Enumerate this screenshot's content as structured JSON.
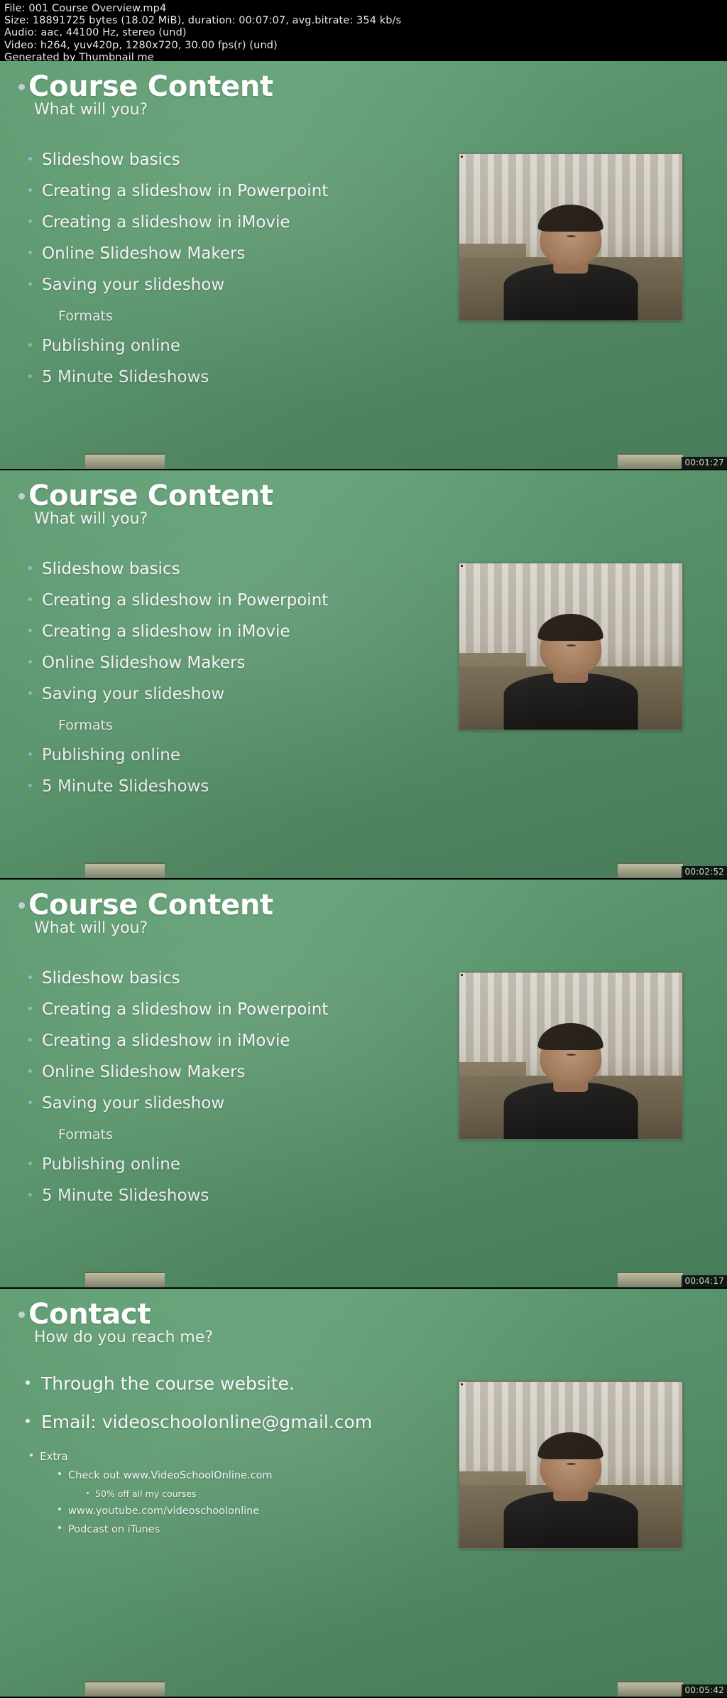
{
  "header": {
    "lines": [
      "File: 001 Course Overview.mp4",
      "Size: 18891725 bytes (18.02 MiB), duration: 00:07:07, avg.bitrate: 354 kb/s",
      "Audio: aac, 44100 Hz, stereo (und)",
      "Video: h264, yuv420p, 1280x720, 30.00 fps(r) (und)",
      "Generated by Thumbnail me"
    ],
    "file_label": "File: 001 Course Overview.mp4",
    "size_label": "Size: 18891725 bytes (18.02 MiB), duration: 00:07:07, avg.bitrate: 354 kb/s",
    "audio_label": "Audio: aac, 44100 Hz, stereo (und)",
    "video_label": "Video: h264, yuv420p, 1280x720, 30.00 fps(r) (und)",
    "generator_label": "Generated by Thumbnail me",
    "filename": "001 Course Overview.mp4",
    "size_bytes": "18891725",
    "size_human": "18.02 MiB",
    "duration": "00:07:07",
    "avg_bitrate": "354 kb/s",
    "audio_codec": "aac",
    "audio_rate": "44100 Hz",
    "audio_channels": "stereo (und)",
    "video_codec": "h264",
    "pixel_format": "yuv420p",
    "resolution": "1280x720",
    "fps": "30.00 fps(r) (und)",
    "background": "#000000",
    "text_color": "#e9e9e9"
  },
  "slides": [
    {
      "title": "Course Content",
      "subtitle": "What will you?",
      "timestamp": "00:01:27",
      "bullets": [
        {
          "text": "Slideshow basics",
          "level": 1
        },
        {
          "text": "Creating a slideshow in Powerpoint",
          "level": 1
        },
        {
          "text": "Creating a slideshow in iMovie",
          "level": 1
        },
        {
          "text": "Online Slideshow Makers",
          "level": 1
        },
        {
          "text": "Saving your slideshow",
          "level": 1
        },
        {
          "text": "Formats",
          "level": 2
        },
        {
          "text": "Publishing online",
          "level": 1
        },
        {
          "text": "5 Minute Slideshows",
          "level": 1
        }
      ]
    },
    {
      "title": "Course Content",
      "subtitle": "What will you?",
      "timestamp": "00:02:52",
      "bullets": [
        {
          "text": "Slideshow basics",
          "level": 1
        },
        {
          "text": "Creating a slideshow in Powerpoint",
          "level": 1
        },
        {
          "text": "Creating a slideshow in iMovie",
          "level": 1
        },
        {
          "text": "Online Slideshow Makers",
          "level": 1
        },
        {
          "text": "Saving your slideshow",
          "level": 1
        },
        {
          "text": "Formats",
          "level": 2
        },
        {
          "text": "Publishing online",
          "level": 1
        },
        {
          "text": "5 Minute Slideshows",
          "level": 1
        }
      ]
    },
    {
      "title": "Course Content",
      "subtitle": "What will you?",
      "timestamp": "00:04:17",
      "bullets": [
        {
          "text": "Slideshow basics",
          "level": 1
        },
        {
          "text": "Creating a slideshow in Powerpoint",
          "level": 1
        },
        {
          "text": "Creating a slideshow in iMovie",
          "level": 1
        },
        {
          "text": "Online Slideshow Makers",
          "level": 1
        },
        {
          "text": "Saving your slideshow",
          "level": 1
        },
        {
          "text": "Formats",
          "level": 2
        },
        {
          "text": "Publishing online",
          "level": 1
        },
        {
          "text": "5 Minute Slideshows",
          "level": 1
        }
      ]
    },
    {
      "title": "Contact",
      "subtitle": "How do you reach me?",
      "timestamp": "00:05:42",
      "contact": true,
      "bullets": [
        {
          "text": "Through the course website.",
          "level": 1
        },
        {
          "text": "Email: videoschoolonline@gmail.com",
          "level": 1
        },
        {
          "text": "Extra",
          "level": 2
        },
        {
          "text": "Check out www.VideoSchoolOnline.com",
          "level": 3
        },
        {
          "text": "50% off all my courses",
          "level": 4
        },
        {
          "text": "www.youtube.com/videoschoolonline",
          "level": 3
        },
        {
          "text": "Podcast on iTunes",
          "level": 3
        }
      ]
    }
  ],
  "theme": {
    "slide_green": "#5f9d72",
    "title_color": "#ffffff",
    "bullet_dot_color": "#9fc0d8",
    "timestamp_bg": "rgba(0,0,0,0.8)"
  }
}
